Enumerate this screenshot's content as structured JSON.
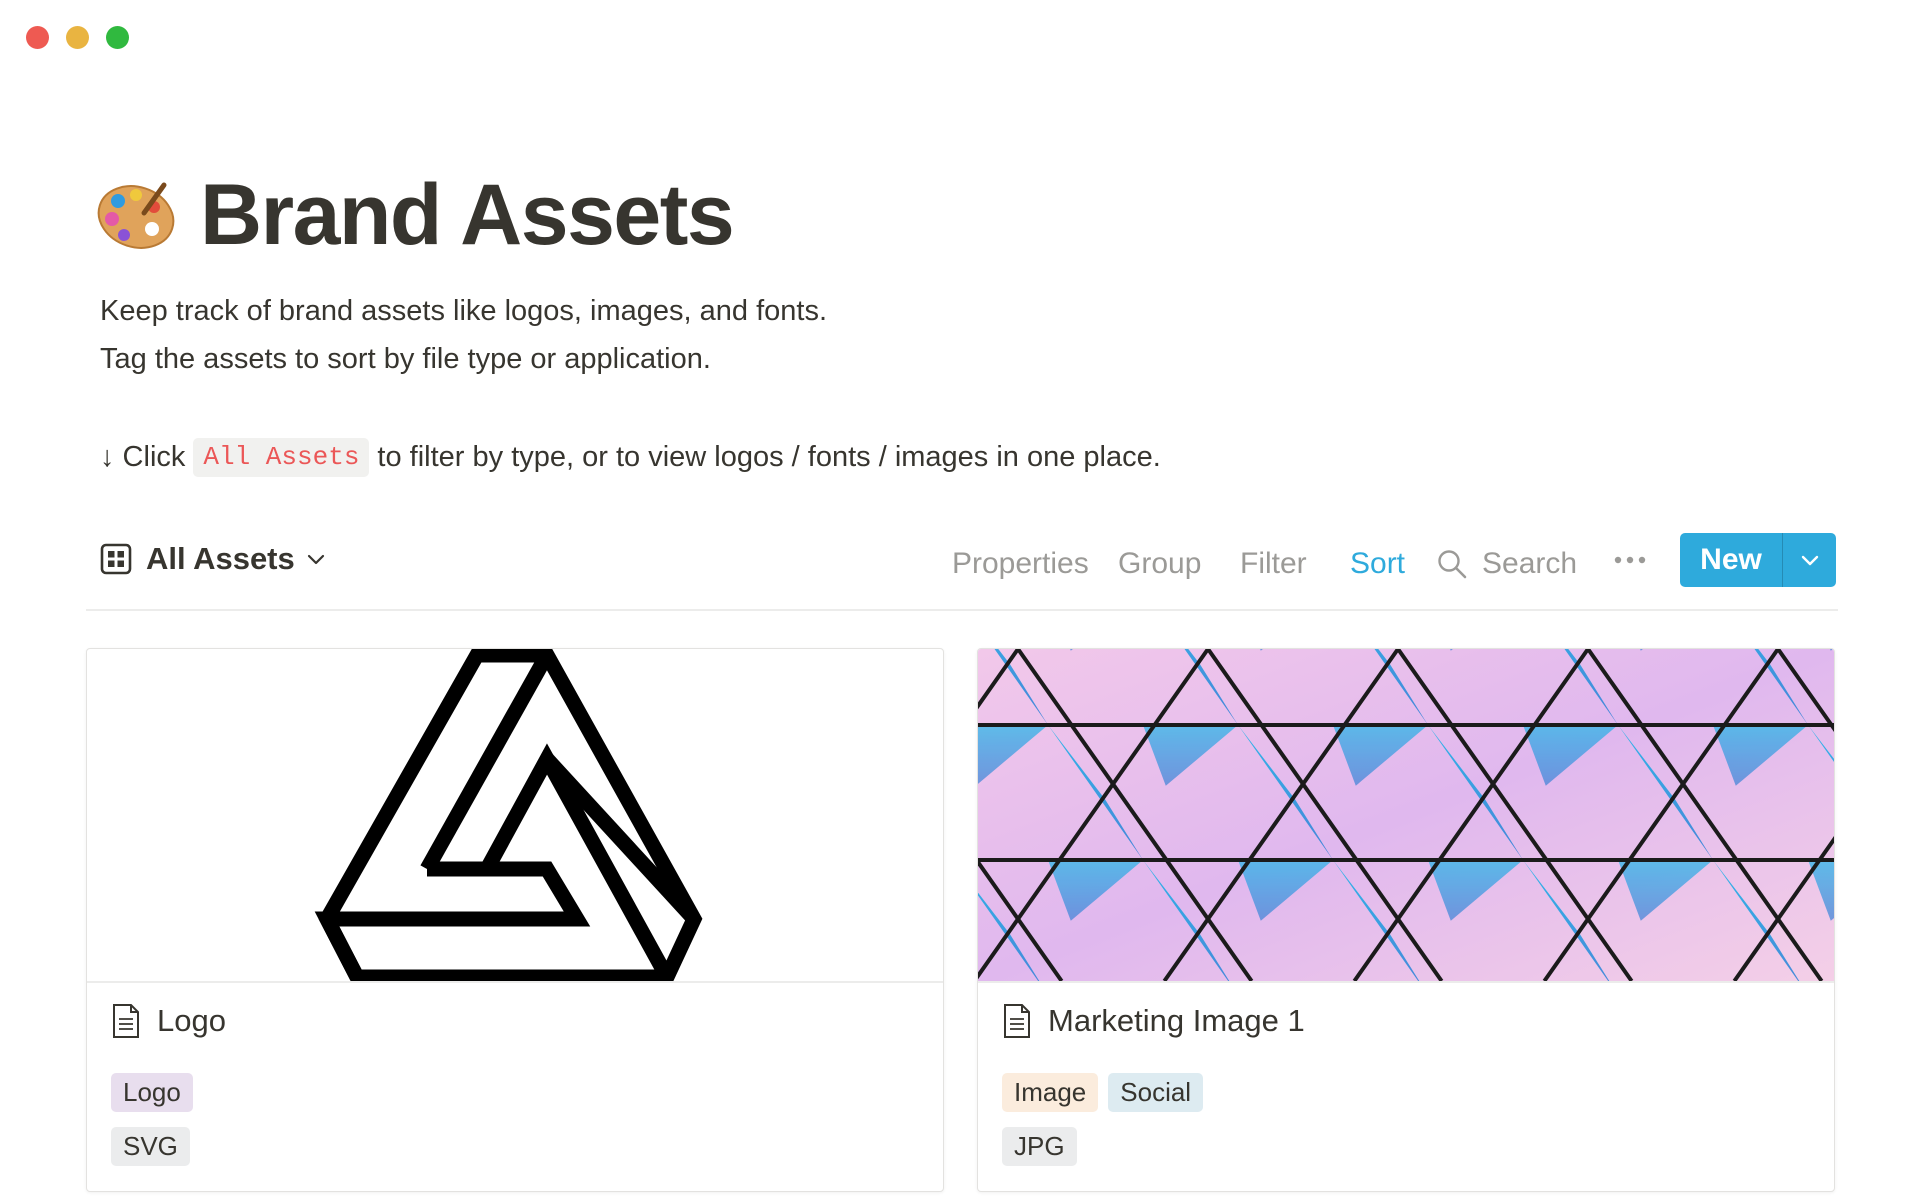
{
  "page": {
    "icon": "artist-palette-icon",
    "title": "Brand Assets",
    "description_line1": "Keep track of brand assets like logos, images, and fonts.",
    "description_line2": "Tag the assets to sort by file type or application.",
    "instruction_prefix": "↓ Click",
    "instruction_code": "All Assets",
    "instruction_suffix": "to filter by type, or to view logos / fonts / images in one place."
  },
  "toolbar": {
    "view_label": "All Assets",
    "properties": "Properties",
    "group": "Group",
    "filter": "Filter",
    "sort": "Sort",
    "search": "Search",
    "new_label": "New"
  },
  "colors": {
    "accent": "#2eaadc",
    "code_text": "#eb5757"
  },
  "cards": [
    {
      "title": "Logo",
      "cover": "impossible-triangle-logo",
      "tags": [
        {
          "label": "Logo",
          "color": "purple"
        }
      ],
      "type": "SVG"
    },
    {
      "title": "Marketing Image 1",
      "cover": "geometric-triangle-pattern-photo",
      "tags": [
        {
          "label": "Image",
          "color": "orange"
        },
        {
          "label": "Social",
          "color": "blue"
        }
      ],
      "type": "JPG"
    }
  ]
}
